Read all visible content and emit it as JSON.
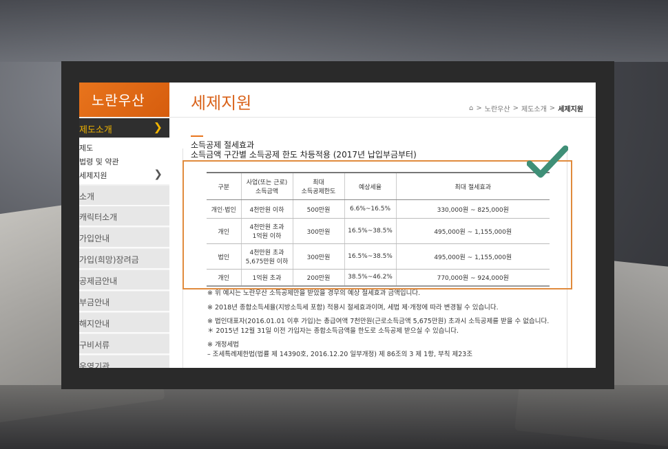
{
  "sidebar": {
    "brand": "노란우산",
    "active": "제도소개",
    "sub_items": [
      "제도",
      "법령 및 약관",
      "세제지원"
    ],
    "items": [
      "소개",
      "캐릭터소개",
      "가입안내",
      "가입(희망)장려금",
      "공제금안내",
      "부금안내",
      "해지안내",
      "구비서류",
      "운영기관"
    ]
  },
  "header": {
    "title": "세제지원",
    "breadcrumb": [
      "노란우산",
      "제도소개",
      "세제지원"
    ]
  },
  "content": {
    "heading1": "소득공제 절세효과",
    "heading2": "소득금액 구간별 소득공제 한도 차등적용 (2017년 납입부금부터)",
    "table": {
      "headers": [
        "구분",
        "사업(또는 근로)\n소득금액",
        "최대\n소득공제한도",
        "예상세율",
        "최대 절세효과"
      ],
      "rows": [
        [
          "개인·법인",
          "4천만원 이하",
          "500만원",
          "6.6%~16.5%",
          "330,000원 ~ 825,000원"
        ],
        [
          "개인",
          "4천만원 초과\n1억원 이하",
          "300만원",
          "16.5%~38.5%",
          "495,000원 ~ 1,155,000원"
        ],
        [
          "법인",
          "4천만원 초과\n5,675만원 이하",
          "300만원",
          "16.5%~38.5%",
          "495,000원 ~ 1,155,000원"
        ],
        [
          "개인",
          "1억원 초과",
          "200만원",
          "38.5%~46.2%",
          "770,000원 ~ 924,000원"
        ]
      ]
    },
    "notes": [
      "※ 위 예시는 노란우산 소득공제만을 받았을 경우의 예상 절세효과 금액입니다.",
      "※ 2018년 종합소득세율(지방소득세 포함) 적용시 절세효과이며, 세법 제·개정에 따라 변경될 수 있습니다.",
      "※ 법인대표자(2016.01.01 이후 가입)는 총급여액 7천만원(근로소득금액 5,675만원) 초과시 소득공제를 받을 수 없습니다.",
      "＊ 2015년 12월 31일 이전 가입자는 종합소득금액을 한도로 소득공제 받으실 수 있습니다.",
      "※ 개정세법",
      "– 조세특례제한법(법률 제 14390호, 2016.12.20 일부개정) 제 86조의 3 제 1항, 부칙 제23조"
    ]
  },
  "colors": {
    "accent": "#e8741c",
    "check": "#3f8f77",
    "sidebar_active": "#f0b400"
  },
  "icons": [
    "home-icon",
    "chevron-right-icon",
    "checkmark-icon"
  ]
}
